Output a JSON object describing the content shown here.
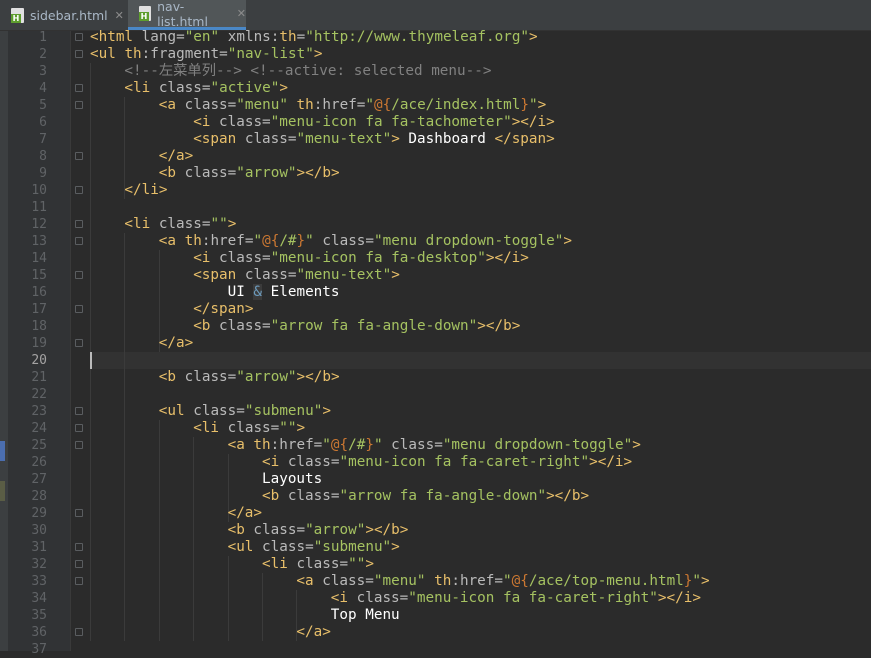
{
  "tabs": [
    {
      "label": "sidebar.html",
      "active": false
    },
    {
      "label": "nav-list.html",
      "active": true
    }
  ],
  "editor": {
    "cursor_line": 20
  },
  "lines": [
    {
      "n": "1",
      "indent": 0,
      "fold": true,
      "segs": [
        [
          "tag",
          "<html "
        ],
        [
          "attr",
          "lang="
        ],
        [
          "str",
          "\"en\" "
        ],
        [
          "attr",
          "xmlns:"
        ],
        [
          "ns",
          "th"
        ],
        [
          "attr",
          "="
        ],
        [
          "str",
          "\"http://www.thymeleaf.org\""
        ],
        [
          "tag",
          ">"
        ]
      ]
    },
    {
      "n": "2",
      "indent": 0,
      "fold": true,
      "segs": [
        [
          "tag",
          "<ul "
        ],
        [
          "ns",
          "th"
        ],
        [
          "attr",
          ":fragment="
        ],
        [
          "str",
          "\"nav-list\""
        ],
        [
          "tag",
          ">"
        ]
      ]
    },
    {
      "n": "3",
      "indent": 4,
      "fold": false,
      "segs": [
        [
          "cmt",
          "<!--左菜单列--> <!--active: selected menu-->"
        ]
      ]
    },
    {
      "n": "4",
      "indent": 4,
      "fold": true,
      "segs": [
        [
          "tag",
          "<li "
        ],
        [
          "attr",
          "class="
        ],
        [
          "str",
          "\"active\""
        ],
        [
          "tag",
          ">"
        ]
      ]
    },
    {
      "n": "5",
      "indent": 8,
      "fold": true,
      "segs": [
        [
          "tag",
          "<a "
        ],
        [
          "attr",
          "class="
        ],
        [
          "str",
          "\"menu\" "
        ],
        [
          "ns",
          "th"
        ],
        [
          "attr",
          ":href="
        ],
        [
          "str",
          "\""
        ],
        [
          "expr",
          "@{"
        ],
        [
          "str",
          "/ace/index.html"
        ],
        [
          "expr",
          "}"
        ],
        [
          "str",
          "\""
        ],
        [
          "tag",
          ">"
        ]
      ]
    },
    {
      "n": "6",
      "indent": 12,
      "fold": false,
      "segs": [
        [
          "tag",
          "<i "
        ],
        [
          "attr",
          "class="
        ],
        [
          "str",
          "\"menu-icon fa fa-tachometer\""
        ],
        [
          "tag",
          "></i>"
        ]
      ]
    },
    {
      "n": "7",
      "indent": 12,
      "fold": false,
      "segs": [
        [
          "tag",
          "<span "
        ],
        [
          "attr",
          "class="
        ],
        [
          "str",
          "\"menu-text\""
        ],
        [
          "tag",
          ">"
        ],
        [
          "txt",
          " Dashboard "
        ],
        [
          "tag",
          "</span>"
        ]
      ]
    },
    {
      "n": "8",
      "indent": 8,
      "fold": true,
      "segs": [
        [
          "tag",
          "</a>"
        ]
      ]
    },
    {
      "n": "9",
      "indent": 8,
      "fold": false,
      "segs": [
        [
          "tag",
          "<b "
        ],
        [
          "attr",
          "class="
        ],
        [
          "str",
          "\"arrow\""
        ],
        [
          "tag",
          "></b>"
        ]
      ]
    },
    {
      "n": "10",
      "indent": 4,
      "fold": true,
      "segs": [
        [
          "tag",
          "</li>"
        ]
      ]
    },
    {
      "n": "11",
      "indent": 0,
      "fold": false,
      "segs": []
    },
    {
      "n": "12",
      "indent": 4,
      "fold": true,
      "segs": [
        [
          "tag",
          "<li "
        ],
        [
          "attr",
          "class="
        ],
        [
          "str",
          "\"\""
        ],
        [
          "tag",
          ">"
        ]
      ]
    },
    {
      "n": "13",
      "indent": 8,
      "fold": true,
      "segs": [
        [
          "tag",
          "<a "
        ],
        [
          "ns",
          "th"
        ],
        [
          "attr",
          ":href="
        ],
        [
          "str",
          "\""
        ],
        [
          "expr",
          "@{"
        ],
        [
          "str",
          "/#"
        ],
        [
          "expr",
          "}"
        ],
        [
          "str",
          "\" "
        ],
        [
          "attr",
          "class="
        ],
        [
          "str",
          "\"menu dropdown-toggle\""
        ],
        [
          "tag",
          ">"
        ]
      ]
    },
    {
      "n": "14",
      "indent": 12,
      "fold": false,
      "segs": [
        [
          "tag",
          "<i "
        ],
        [
          "attr",
          "class="
        ],
        [
          "str",
          "\"menu-icon fa fa-desktop\""
        ],
        [
          "tag",
          "></i>"
        ]
      ]
    },
    {
      "n": "15",
      "indent": 12,
      "fold": true,
      "segs": [
        [
          "tag",
          "<span "
        ],
        [
          "attr",
          "class="
        ],
        [
          "str",
          "\"menu-text\""
        ],
        [
          "tag",
          ">"
        ]
      ]
    },
    {
      "n": "16",
      "indent": 16,
      "fold": false,
      "segs": [
        [
          "txt",
          "UI "
        ],
        [
          "ent",
          "&"
        ],
        [
          "txt",
          " Elements"
        ]
      ]
    },
    {
      "n": "17",
      "indent": 12,
      "fold": true,
      "segs": [
        [
          "tag",
          "</span>"
        ]
      ]
    },
    {
      "n": "18",
      "indent": 12,
      "fold": false,
      "segs": [
        [
          "tag",
          "<b "
        ],
        [
          "attr",
          "class="
        ],
        [
          "str",
          "\"arrow fa fa-angle-down\""
        ],
        [
          "tag",
          "></b>"
        ]
      ]
    },
    {
      "n": "19",
      "indent": 8,
      "fold": true,
      "segs": [
        [
          "tag",
          "</a>"
        ]
      ]
    },
    {
      "n": "20",
      "indent": 0,
      "fold": false,
      "segs": []
    },
    {
      "n": "21",
      "indent": 8,
      "fold": false,
      "segs": [
        [
          "tag",
          "<b "
        ],
        [
          "attr",
          "class="
        ],
        [
          "str",
          "\"arrow\""
        ],
        [
          "tag",
          "></b>"
        ]
      ]
    },
    {
      "n": "22",
      "indent": 0,
      "fold": false,
      "segs": []
    },
    {
      "n": "23",
      "indent": 8,
      "fold": true,
      "segs": [
        [
          "tag",
          "<ul "
        ],
        [
          "attr",
          "class="
        ],
        [
          "str",
          "\"submenu\""
        ],
        [
          "tag",
          ">"
        ]
      ]
    },
    {
      "n": "24",
      "indent": 12,
      "fold": true,
      "segs": [
        [
          "tag",
          "<li "
        ],
        [
          "attr",
          "class="
        ],
        [
          "str",
          "\"\""
        ],
        [
          "tag",
          ">"
        ]
      ]
    },
    {
      "n": "25",
      "indent": 16,
      "fold": true,
      "segs": [
        [
          "tag",
          "<a "
        ],
        [
          "ns",
          "th"
        ],
        [
          "attr",
          ":href="
        ],
        [
          "str",
          "\""
        ],
        [
          "expr",
          "@{"
        ],
        [
          "str",
          "/#"
        ],
        [
          "expr",
          "}"
        ],
        [
          "str",
          "\" "
        ],
        [
          "attr",
          "class="
        ],
        [
          "str",
          "\"menu dropdown-toggle\""
        ],
        [
          "tag",
          ">"
        ]
      ]
    },
    {
      "n": "26",
      "indent": 20,
      "fold": false,
      "segs": [
        [
          "tag",
          "<i "
        ],
        [
          "attr",
          "class="
        ],
        [
          "str",
          "\"menu-icon fa fa-caret-right\""
        ],
        [
          "tag",
          "></i>"
        ]
      ]
    },
    {
      "n": "27",
      "indent": 20,
      "fold": false,
      "segs": [
        [
          "txt",
          "Layouts"
        ]
      ]
    },
    {
      "n": "28",
      "indent": 20,
      "fold": false,
      "segs": [
        [
          "tag",
          "<b "
        ],
        [
          "attr",
          "class="
        ],
        [
          "str",
          "\"arrow fa fa-angle-down\""
        ],
        [
          "tag",
          "></b>"
        ]
      ]
    },
    {
      "n": "29",
      "indent": 16,
      "fold": true,
      "segs": [
        [
          "tag",
          "</a>"
        ]
      ]
    },
    {
      "n": "30",
      "indent": 16,
      "fold": false,
      "segs": [
        [
          "tag",
          "<b "
        ],
        [
          "attr",
          "class="
        ],
        [
          "str",
          "\"arrow\""
        ],
        [
          "tag",
          "></b>"
        ]
      ]
    },
    {
      "n": "31",
      "indent": 16,
      "fold": true,
      "segs": [
        [
          "tag",
          "<ul "
        ],
        [
          "attr",
          "class="
        ],
        [
          "str",
          "\"submenu\""
        ],
        [
          "tag",
          ">"
        ]
      ]
    },
    {
      "n": "32",
      "indent": 20,
      "fold": true,
      "segs": [
        [
          "tag",
          "<li "
        ],
        [
          "attr",
          "class="
        ],
        [
          "str",
          "\"\""
        ],
        [
          "tag",
          ">"
        ]
      ]
    },
    {
      "n": "33",
      "indent": 24,
      "fold": true,
      "segs": [
        [
          "tag",
          "<a "
        ],
        [
          "attr",
          "class="
        ],
        [
          "str",
          "\"menu\" "
        ],
        [
          "ns",
          "th"
        ],
        [
          "attr",
          ":href="
        ],
        [
          "str",
          "\""
        ],
        [
          "expr",
          "@{"
        ],
        [
          "str",
          "/ace/top-menu.html"
        ],
        [
          "expr",
          "}"
        ],
        [
          "str",
          "\""
        ],
        [
          "tag",
          ">"
        ]
      ]
    },
    {
      "n": "34",
      "indent": 28,
      "fold": false,
      "segs": [
        [
          "tag",
          "<i "
        ],
        [
          "attr",
          "class="
        ],
        [
          "str",
          "\"menu-icon fa fa-caret-right\""
        ],
        [
          "tag",
          "></i>"
        ]
      ]
    },
    {
      "n": "35",
      "indent": 28,
      "fold": false,
      "segs": [
        [
          "txt",
          "Top Menu"
        ]
      ]
    },
    {
      "n": "36",
      "indent": 24,
      "fold": true,
      "segs": [
        [
          "tag",
          "</a>"
        ]
      ]
    },
    {
      "n": "37",
      "indent": 0,
      "fold": false,
      "segs": []
    }
  ]
}
